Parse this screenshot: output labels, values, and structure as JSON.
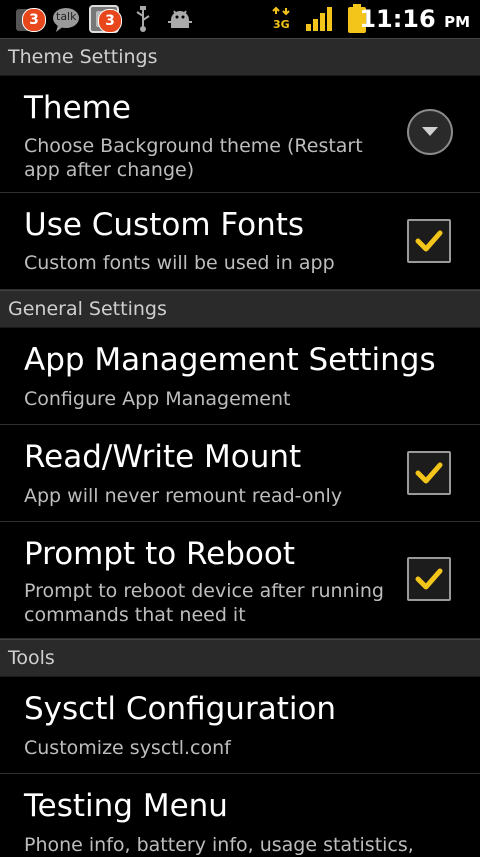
{
  "statusbar": {
    "notif_badge_1": "3",
    "talk_label": "talk",
    "notif_badge_2": "3",
    "network": "3G",
    "time": "11:16",
    "ampm": "PM"
  },
  "sections": [
    {
      "title": "Theme Settings"
    },
    {
      "title": "General Settings"
    },
    {
      "title": "Tools"
    }
  ],
  "prefs": {
    "theme": {
      "title": "Theme",
      "summary": "Choose Background theme (Restart app after change)"
    },
    "custom_fonts": {
      "title": "Use Custom Fonts",
      "summary": "Custom fonts will be used in app",
      "checked": true
    },
    "app_mgmt": {
      "title": "App Management Settings",
      "summary": "Configure App Management"
    },
    "rw_mount": {
      "title": "Read/Write Mount",
      "summary": "App will never remount read-only",
      "checked": true
    },
    "prompt_reboot": {
      "title": "Prompt to Reboot",
      "summary": "Prompt to reboot device after running commands that need it",
      "checked": true
    },
    "sysctl": {
      "title": "Sysctl Configuration",
      "summary": "Customize sysctl.conf"
    },
    "testing": {
      "title": "Testing Menu",
      "summary": "Phone info, battery info, usage statistics,"
    }
  },
  "colors": {
    "check": "#f3c419",
    "badge": "#e8471c",
    "header_bg": "#2a2a2a"
  }
}
